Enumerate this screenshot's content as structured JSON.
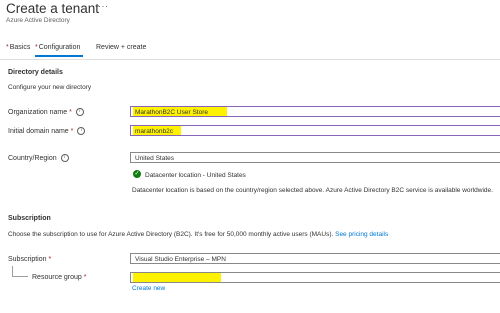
{
  "header": {
    "title": "Create a tenant",
    "subtitle": "Azure Active Directory",
    "more_label": "···"
  },
  "tabs": [
    {
      "label": "Basics",
      "required": "*"
    },
    {
      "label": "Configuration",
      "required": "*"
    },
    {
      "label": "Review + create",
      "required": ""
    }
  ],
  "directory": {
    "heading": "Directory details",
    "description": "Configure your new directory",
    "org_label": "Organization name",
    "org_value": "MarathonB2C User Store",
    "domain_label": "Initial domain name",
    "domain_value": "marathonb2c",
    "country_label": "Country/Region",
    "country_value": "United States",
    "datacenter_status": "Datacenter location - United States",
    "datacenter_note": "Datacenter location is based on the country/region selected above. Azure Active Directory B2C service is available worldwide."
  },
  "subscription": {
    "heading": "Subscription",
    "description": "Choose the subscription to use for Azure Active Directory (B2C). It's free for 50,000 monthly active users (MAUs).",
    "pricing_link": "See pricing details",
    "subscription_label": "Subscription",
    "subscription_value": "Visual Studio Enterprise – MPN",
    "rg_label": "Resource group",
    "rg_value": "",
    "create_new": "Create new"
  },
  "required_marker": "*",
  "info_icon_glyph": "i",
  "check_glyph": "✓",
  "colors": {
    "accent": "#0078d4",
    "highlight": "#fff200",
    "success": "#107c10",
    "required": "#a4262c"
  }
}
